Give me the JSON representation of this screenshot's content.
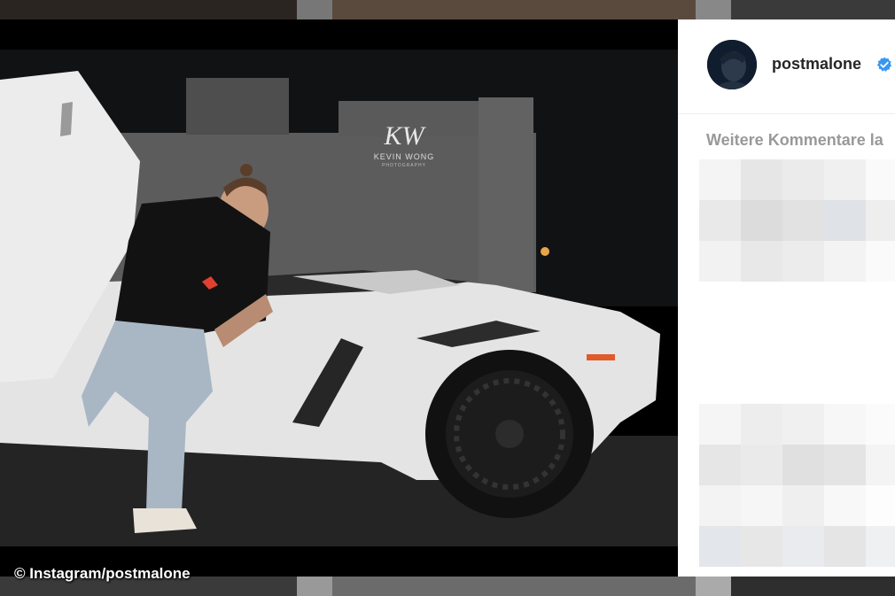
{
  "watermark": "© Instagram/postmalone",
  "panel": {
    "username": "postmalone",
    "verified": true,
    "load_more_label": "Weitere Kommentare la"
  },
  "photo_sign": {
    "monogram": "KW",
    "line1": "KEVIN WONG",
    "line2": "PHOTOGRAPHY"
  },
  "icons": {
    "verified": "verified-badge-icon",
    "avatar": "profile-avatar"
  },
  "colors": {
    "verified_blue": "#3897f0",
    "username": "#262626",
    "muted": "#999999",
    "panel_bg": "#ffffff"
  }
}
